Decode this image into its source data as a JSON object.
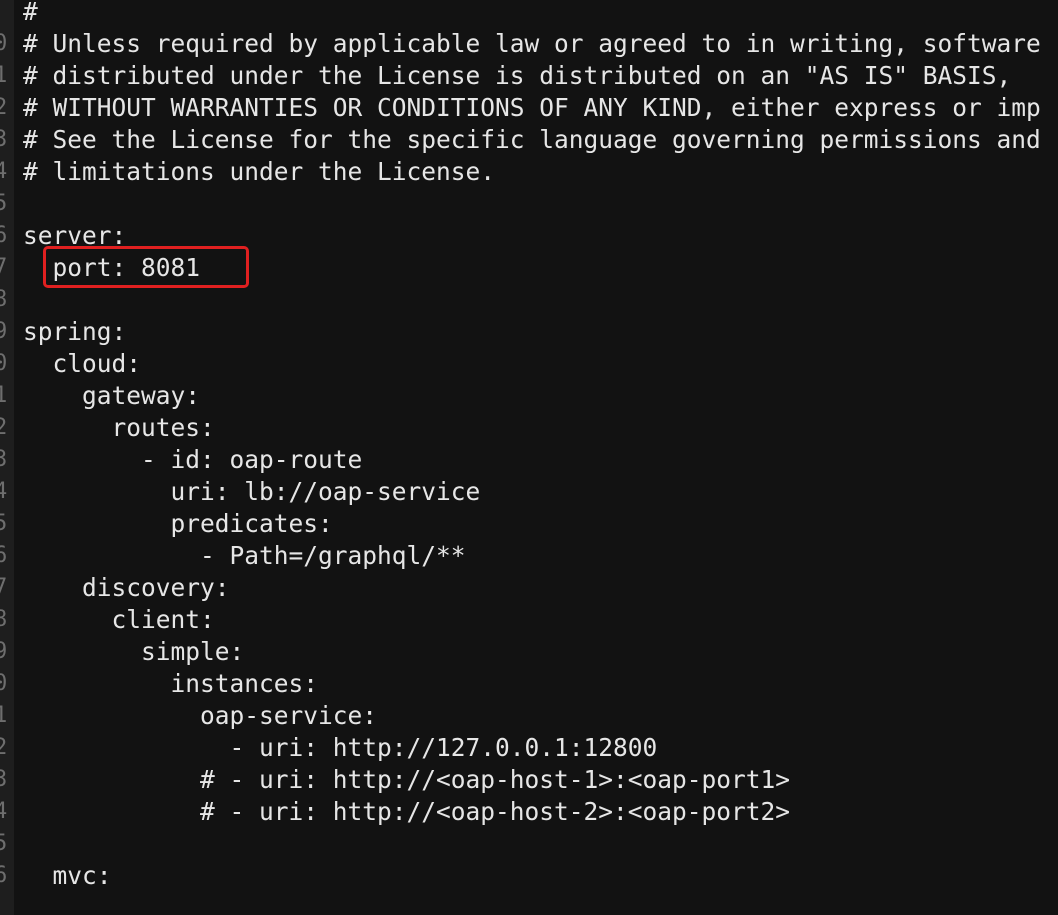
{
  "editor": {
    "lines": [
      {
        "num": "",
        "text": "#"
      },
      {
        "num": "0",
        "text": "# Unless required by applicable law or agreed to in writing, software"
      },
      {
        "num": "1",
        "text": "# distributed under the License is distributed on an \"AS IS\" BASIS,"
      },
      {
        "num": "2",
        "text": "# WITHOUT WARRANTIES OR CONDITIONS OF ANY KIND, either express or imp"
      },
      {
        "num": "3",
        "text": "# See the License for the specific language governing permissions and"
      },
      {
        "num": "4",
        "text": "# limitations under the License."
      },
      {
        "num": "5",
        "text": ""
      },
      {
        "num": "6",
        "text": "server:"
      },
      {
        "num": "7",
        "text": "  port: 8081"
      },
      {
        "num": "8",
        "text": ""
      },
      {
        "num": "9",
        "text": "spring:"
      },
      {
        "num": "0",
        "text": "  cloud:"
      },
      {
        "num": "1",
        "text": "    gateway:"
      },
      {
        "num": "2",
        "text": "      routes:"
      },
      {
        "num": "3",
        "text": "        - id: oap-route"
      },
      {
        "num": "4",
        "text": "          uri: lb://oap-service"
      },
      {
        "num": "5",
        "text": "          predicates:"
      },
      {
        "num": "6",
        "text": "            - Path=/graphql/**"
      },
      {
        "num": "7",
        "text": "    discovery:"
      },
      {
        "num": "8",
        "text": "      client:"
      },
      {
        "num": "9",
        "text": "        simple:"
      },
      {
        "num": "0",
        "text": "          instances:"
      },
      {
        "num": "1",
        "text": "            oap-service:"
      },
      {
        "num": "2",
        "text": "              - uri: http://127.0.0.1:12800"
      },
      {
        "num": "3",
        "text": "            # - uri: http://<oap-host-1>:<oap-port1>"
      },
      {
        "num": "4",
        "text": "            # - uri: http://<oap-host-2>:<oap-port2>"
      },
      {
        "num": "5",
        "text": ""
      },
      {
        "num": "6",
        "text": "  mvc:"
      }
    ]
  },
  "colors": {
    "background": "#121212",
    "text": "#e6e6e6",
    "highlight_border": "#e02020"
  }
}
